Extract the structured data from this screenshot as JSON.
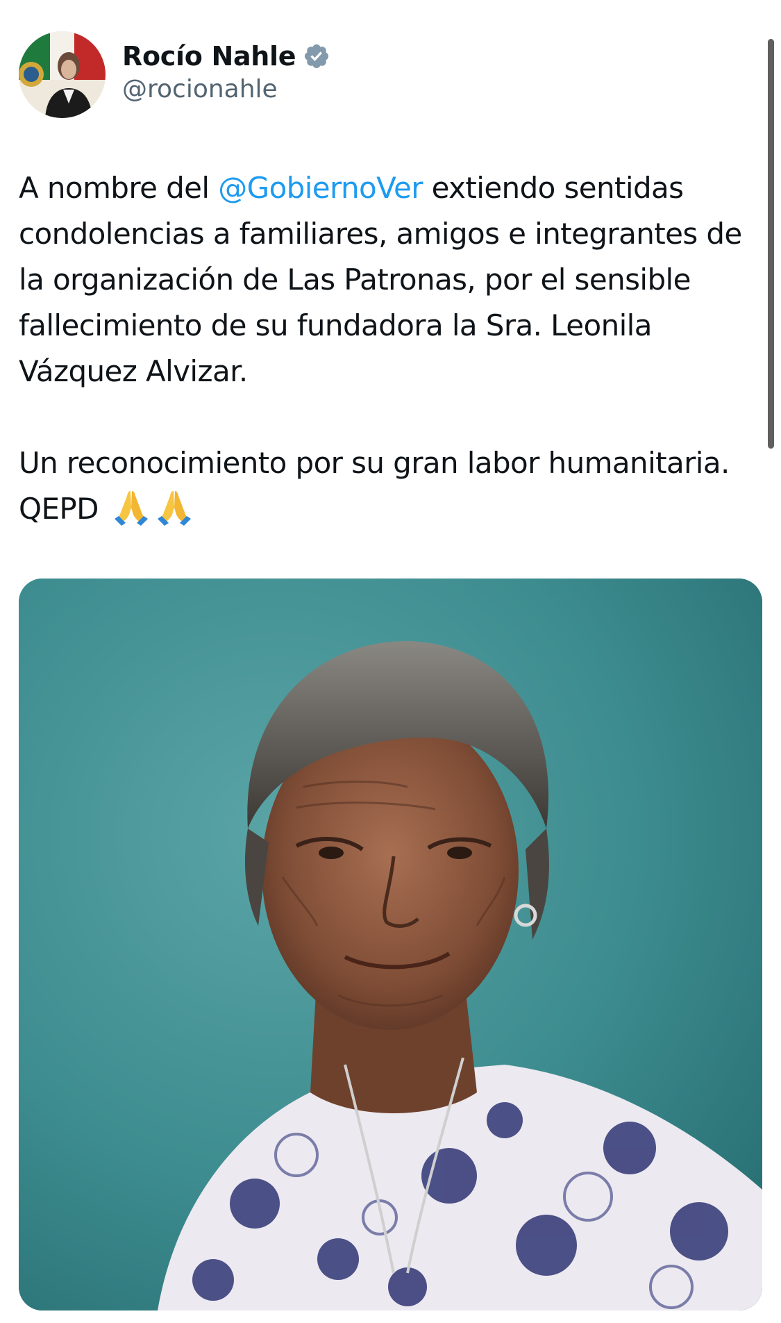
{
  "author": {
    "display_name": "Rocío Nahle",
    "handle": "@rocionahle",
    "verified": true,
    "avatar_icon": "profile-photo"
  },
  "tweet": {
    "text_part1": "A nombre del ",
    "mention": "@GobiernoVer",
    "text_part2": " extiendo sentidas condolencias a familiares, amigos e integrantes de la organización de Las Patronas, por el sensible fallecimiento de su fundadora la Sra. Leonila Vázquez Alvizar.",
    "text_part3": "Un reconocimiento por su gran labor humanitaria.",
    "text_part4": "QEPD",
    "emoji": [
      "folded-hands-icon",
      "folded-hands-icon"
    ]
  },
  "media": {
    "type": "photo",
    "subject": "portrait-photo"
  },
  "colors": {
    "mention": "#1d9bf0",
    "handle": "#536471",
    "text": "#0f1419",
    "verified_badge": "#829aab"
  }
}
